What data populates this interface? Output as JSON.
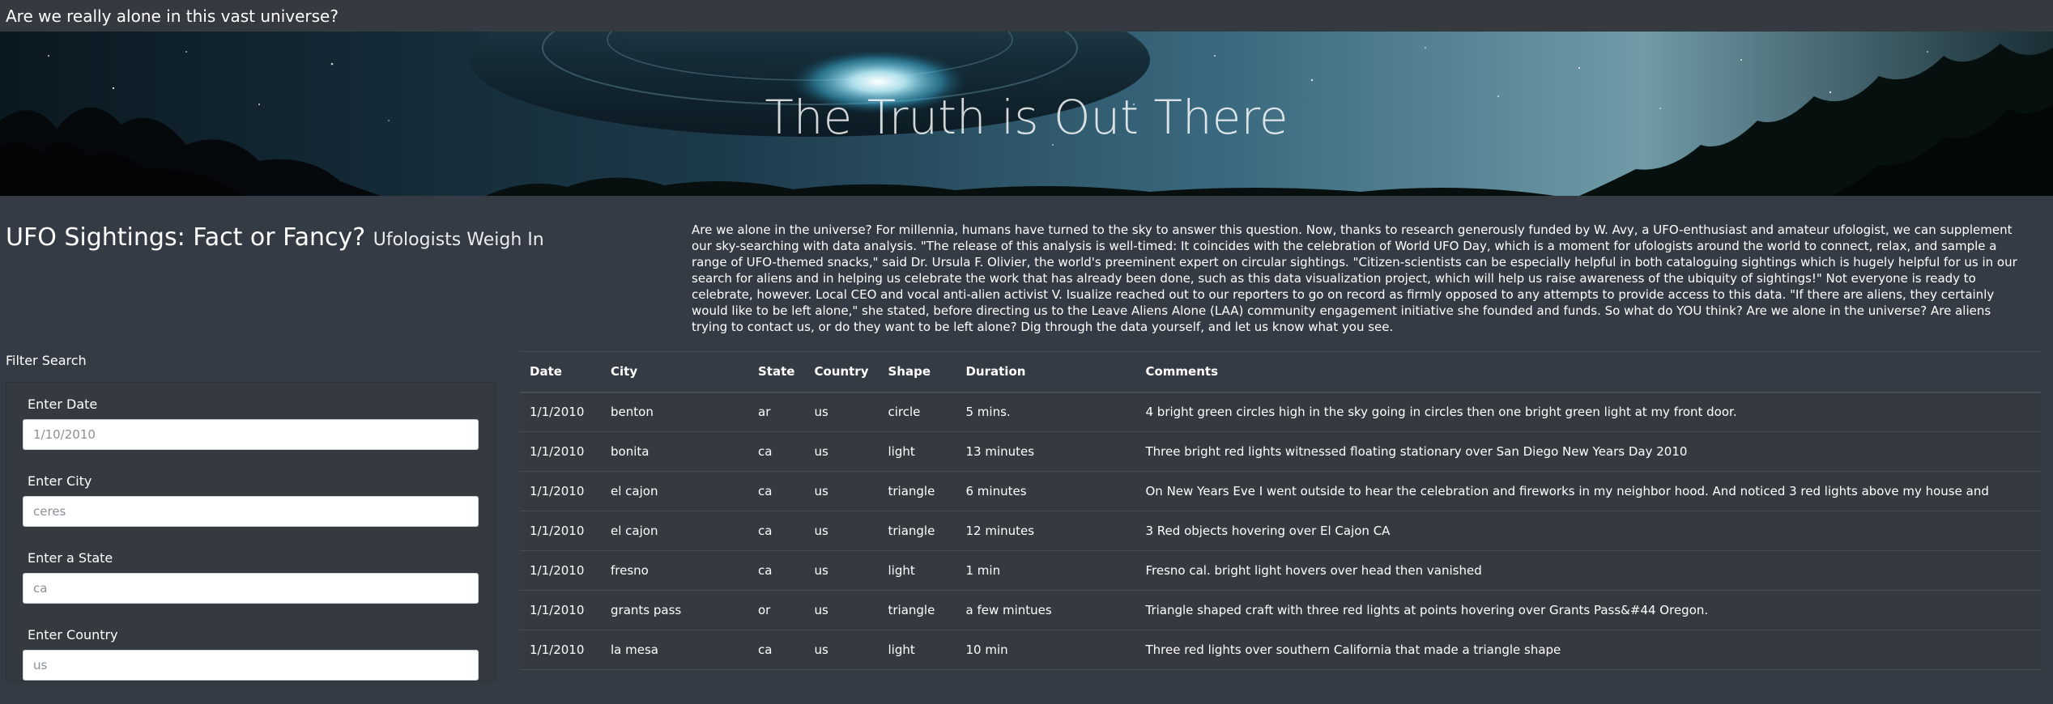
{
  "navbar": {
    "brand": "Are we really alone in this vast universe?"
  },
  "hero": {
    "title": "The Truth is Out There"
  },
  "section": {
    "title": "UFO Sightings: Fact or Fancy?",
    "subtitle": "Ufologists Weigh In"
  },
  "intro": {
    "text": "Are we alone in the universe? For millennia, humans have turned to the sky to answer this question. Now, thanks to research generously funded by W. Avy, a UFO-enthusiast and amateur ufologist, we can supplement our sky-searching with data analysis. \"The release of this analysis is well-timed: It coincides with the celebration of World UFO Day, which is a moment for ufologists around the world to connect, relax, and sample a range of UFO-themed snacks,\" said Dr. Ursula F. Olivier, the world's preeminent expert on circular sightings. \"Citizen-scientists can be especially helpful in both cataloguing sightings which is hugely helpful for us in our search for aliens and in helping us celebrate the work that has already been done, such as this data visualization project, which will help us raise awareness of the ubiquity of sightings!\" Not everyone is ready to celebrate, however. Local CEO and vocal anti-alien activist V. Isualize reached out to our reporters to go on record as firmly opposed to any attempts to provide access to this data. \"If there are aliens, they certainly would like to be left alone,\" she stated, before directing us to the Leave Aliens Alone (LAA) community engagement initiative she founded and funds. So what do YOU think? Are we alone in the universe? Are aliens trying to contact us, or do they want to be left alone? Dig through the data yourself, and let us know what you see."
  },
  "filters": {
    "heading": "Filter Search",
    "items": [
      {
        "label": "Enter Date",
        "placeholder": "1/10/2010"
      },
      {
        "label": "Enter City",
        "placeholder": "ceres"
      },
      {
        "label": "Enter a State",
        "placeholder": "ca"
      },
      {
        "label": "Enter Country",
        "placeholder": "us"
      }
    ]
  },
  "table": {
    "headers": [
      "Date",
      "City",
      "State",
      "Country",
      "Shape",
      "Duration",
      "Comments"
    ],
    "rows": [
      [
        "1/1/2010",
        "benton",
        "ar",
        "us",
        "circle",
        "5 mins.",
        "4 bright green circles high in the sky going in circles then one bright green light at my front door."
      ],
      [
        "1/1/2010",
        "bonita",
        "ca",
        "us",
        "light",
        "13 minutes",
        "Three bright red lights witnessed floating stationary over San Diego New Years Day 2010"
      ],
      [
        "1/1/2010",
        "el cajon",
        "ca",
        "us",
        "triangle",
        "6 minutes",
        "On New Years Eve I went outside to hear the celebration and fireworks in my neighbor hood. And noticed 3 red lights above my house and"
      ],
      [
        "1/1/2010",
        "el cajon",
        "ca",
        "us",
        "triangle",
        "12 minutes",
        "3 Red objects hovering over El Cajon CA"
      ],
      [
        "1/1/2010",
        "fresno",
        "ca",
        "us",
        "light",
        "1 min",
        "Fresno cal. bright light hovers over head then vanished"
      ],
      [
        "1/1/2010",
        "grants pass",
        "or",
        "us",
        "triangle",
        "a few mintues",
        "Triangle shaped craft with three red lights at points hovering over Grants Pass&#44 Oregon."
      ],
      [
        "1/1/2010",
        "la mesa",
        "ca",
        "us",
        "light",
        "10 min",
        "Three red lights over southern California that made a triangle shape"
      ]
    ]
  },
  "colors": {
    "page_bg": "#353b44",
    "navbar_bg": "#343a40",
    "table_border": "#454d55"
  }
}
